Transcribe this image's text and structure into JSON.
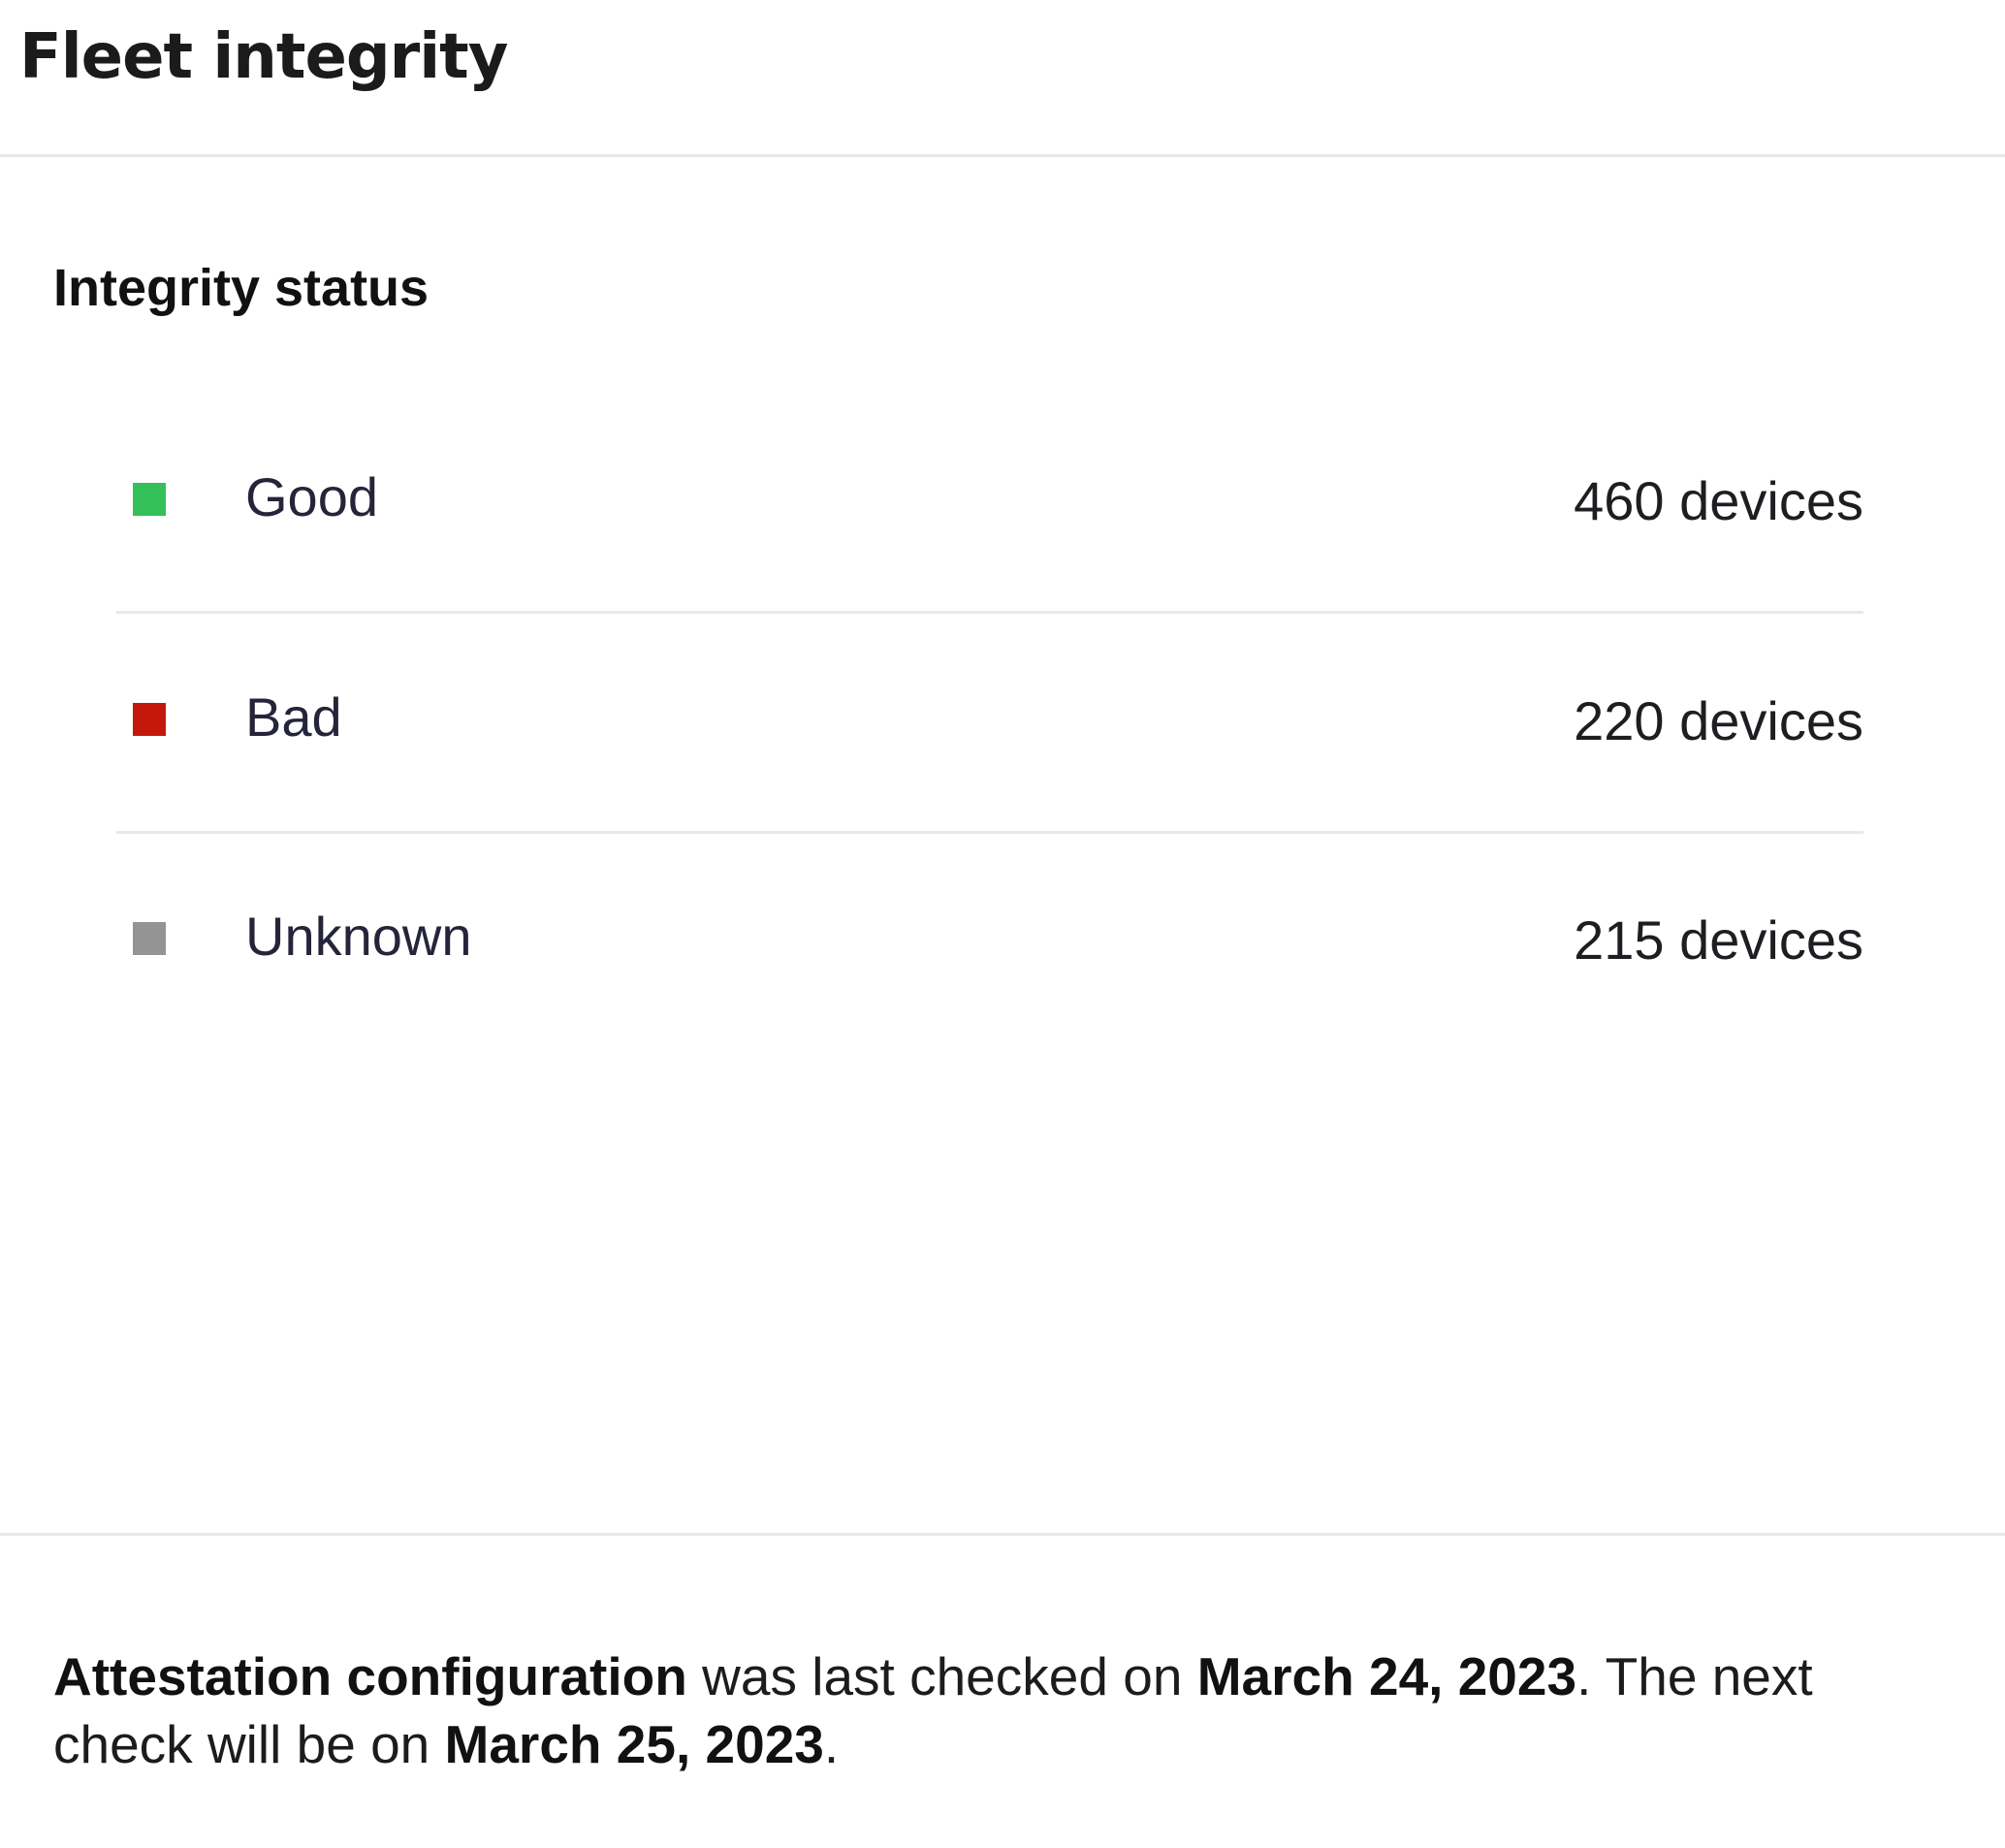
{
  "header": {
    "title": "Fleet integrity"
  },
  "integrity": {
    "section_title": "Integrity status",
    "rows": [
      {
        "label": "Good",
        "count": "460 devices",
        "color": "#33c05a"
      },
      {
        "label": "Bad",
        "count": "220 devices",
        "color": "#c4180c"
      },
      {
        "label": "Unknown",
        "count": "215 devices",
        "color": "#949494"
      }
    ]
  },
  "footer": {
    "link_text": "Attestation configuration",
    "text_1": " was last checked on ",
    "last_checked": "March 24, 2023",
    "text_2": ". The next check will be on ",
    "next_check": "March 25, 2023",
    "text_3": "."
  }
}
